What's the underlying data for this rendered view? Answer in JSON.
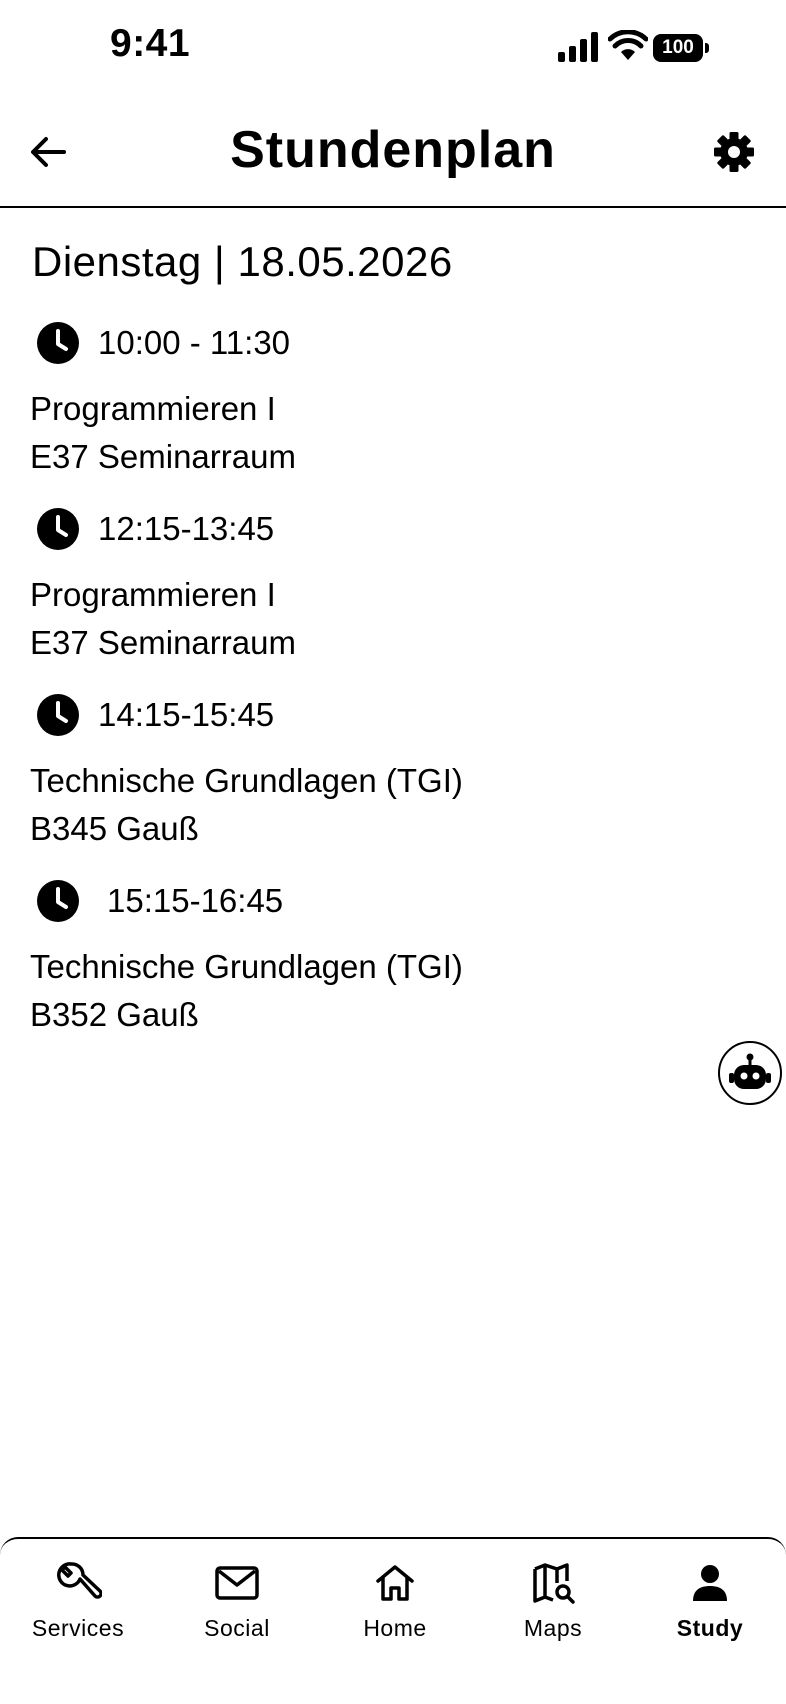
{
  "status_bar": {
    "time": "9:41",
    "battery": "100"
  },
  "header": {
    "title": "Stundenplan"
  },
  "schedule": {
    "date": "Dienstag | 18.05.2026",
    "entries": [
      {
        "time": "10:00 - 11:30",
        "course": "Programmieren I",
        "room": "E37 Seminarraum"
      },
      {
        "time": "12:15-13:45",
        "course": "Programmieren I",
        "room": "E37 Seminarraum"
      },
      {
        "time": "14:15-15:45",
        "course": "Technische Grundlagen (TGI)",
        "room": "B345 Gauß"
      },
      {
        "time": "15:15-16:45",
        "course": "Technische Grundlagen (TGI)",
        "room": "B352 Gauß"
      }
    ]
  },
  "nav": {
    "items": [
      {
        "label": "Services",
        "icon": "wrench-icon"
      },
      {
        "label": "Social",
        "icon": "mail-icon"
      },
      {
        "label": "Home",
        "icon": "home-icon"
      },
      {
        "label": "Maps",
        "icon": "map-search-icon"
      },
      {
        "label": "Study",
        "icon": "person-icon",
        "active": true
      }
    ]
  }
}
